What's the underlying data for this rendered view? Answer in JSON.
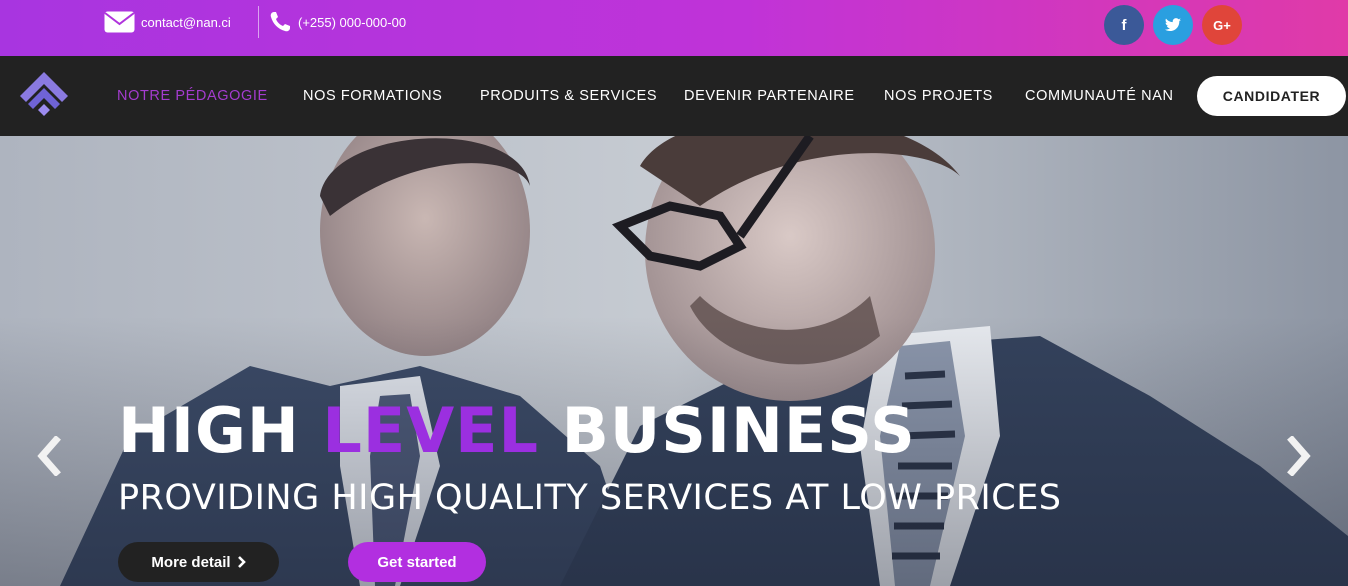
{
  "topbar": {
    "email": "contact@nan.ci",
    "phone": "(+255) 000-000-00",
    "email_icon": "envelope-icon",
    "phone_icon": "phone-icon",
    "social": [
      {
        "name": "facebook-icon",
        "glyph": "f"
      },
      {
        "name": "twitter-icon",
        "glyph": "t"
      },
      {
        "name": "google-plus-icon",
        "glyph": "G+"
      }
    ]
  },
  "nav": {
    "items": [
      {
        "label": "NOTRE PÉDAGOGIE",
        "active": true
      },
      {
        "label": "NOS FORMATIONS"
      },
      {
        "label": "PRODUITS & SERVICES"
      },
      {
        "label": "DEVENIR PARTENAIRE"
      },
      {
        "label": "NOS PROJETS"
      },
      {
        "label": "COMMUNAUTÉ NAN"
      }
    ],
    "cta": "CANDIDATER"
  },
  "hero": {
    "headline_part1": "HIGH",
    "headline_accent": "LEVEL",
    "headline_part2": "BUSINESS",
    "subline": "PROVIDING HIGH QUALITY SERVICES AT LOW PRICES",
    "more_button": "More detail",
    "start_button": "Get started"
  },
  "colors": {
    "accent": "#9b2fe0",
    "topbar_start": "#a835e0",
    "topbar_end": "#e03aa8",
    "nav_bg": "#222222"
  }
}
